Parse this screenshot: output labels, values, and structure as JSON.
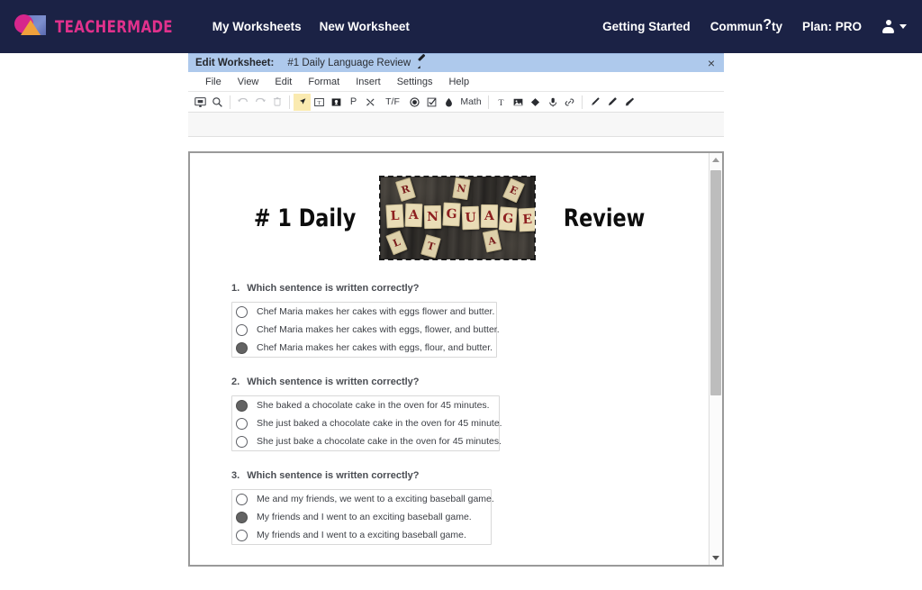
{
  "navbar": {
    "brand_name": "TEACHERMADE",
    "brand_color": "#e0318c",
    "background": "#1b2245",
    "logo_icon": "teachermade-logo-icon",
    "left_links": [
      {
        "label": "My Worksheets"
      },
      {
        "label": "New Worksheet"
      }
    ],
    "right_links": [
      {
        "label": "Getting Started"
      },
      {
        "label_prefix": "Commun",
        "label_mark": "?",
        "label_suffix": "ty"
      },
      {
        "label": "Plan: PRO"
      }
    ],
    "avatar_icon": "user-avatar-icon",
    "caret_icon": "chevron-down-icon"
  },
  "editor": {
    "title_label": "Edit Worksheet:",
    "worksheet_name": "#1 Daily Language Review",
    "edit_name_icon": "pencil-icon",
    "close_icon": "close-icon",
    "close_label": "×",
    "titlebar_color": "#aec9ec",
    "menus": [
      {
        "label": "File"
      },
      {
        "label": "View"
      },
      {
        "label": "Edit"
      },
      {
        "label": "Format"
      },
      {
        "label": "Insert"
      },
      {
        "label": "Settings"
      },
      {
        "label": "Help"
      }
    ],
    "toolbar_active_color": "#faeab0",
    "toolbar": [
      {
        "name": "present-mode-icon",
        "glyph": "",
        "group": 1,
        "state": "normal"
      },
      {
        "name": "zoom-icon",
        "glyph": "",
        "group": 1,
        "state": "normal"
      },
      {
        "name": "undo-icon",
        "glyph": "",
        "group": 2,
        "state": "disabled"
      },
      {
        "name": "redo-icon",
        "glyph": "",
        "group": 2,
        "state": "disabled"
      },
      {
        "name": "delete-icon",
        "glyph": "",
        "group": 2,
        "state": "disabled"
      },
      {
        "name": "select-cursor-icon",
        "glyph": "",
        "group": 3,
        "state": "active"
      },
      {
        "name": "text-box-icon",
        "glyph": "",
        "group": 3,
        "state": "normal"
      },
      {
        "name": "dropdown-field-icon",
        "glyph": "",
        "group": 3,
        "state": "normal"
      },
      {
        "name": "paragraph-icon",
        "glyph": "P",
        "group": 3,
        "state": "normal"
      },
      {
        "name": "shuffle-icon",
        "glyph": "",
        "group": 3,
        "state": "normal"
      },
      {
        "name": "true-false-icon",
        "glyph": "T/F",
        "group": 3,
        "state": "normal"
      },
      {
        "name": "radio-button-icon",
        "glyph": "",
        "group": 3,
        "state": "normal"
      },
      {
        "name": "checkbox-icon",
        "glyph": "",
        "group": 3,
        "state": "normal"
      },
      {
        "name": "droplet-icon",
        "glyph": "",
        "group": 3,
        "state": "normal"
      },
      {
        "name": "math-icon",
        "glyph": "Math",
        "group": 3,
        "state": "normal"
      },
      {
        "name": "text-icon",
        "glyph": "T",
        "group": 4,
        "state": "normal"
      },
      {
        "name": "image-icon",
        "glyph": "",
        "group": 4,
        "state": "normal"
      },
      {
        "name": "shape-icon",
        "glyph": "",
        "group": 4,
        "state": "normal"
      },
      {
        "name": "audio-recording-icon",
        "glyph": "",
        "group": 4,
        "state": "normal"
      },
      {
        "name": "link-icon",
        "glyph": "",
        "group": 4,
        "state": "normal"
      },
      {
        "name": "pen-icon",
        "glyph": "",
        "group": 5,
        "state": "normal"
      },
      {
        "name": "highlighter-icon",
        "glyph": "",
        "group": 5,
        "state": "normal"
      },
      {
        "name": "eraser-icon",
        "glyph": "",
        "group": 5,
        "state": "normal"
      }
    ]
  },
  "worksheet": {
    "title_left": "# 1  Daily",
    "title_right": "Review",
    "header_image": {
      "name": "language-scrabble-tiles-image",
      "alt_word": "LANGUAGE",
      "tiles": [
        "L",
        "A",
        "N",
        "G",
        "U",
        "A",
        "G",
        "E"
      ],
      "scatter_tiles": [
        "L",
        "T",
        "A",
        "E",
        "R",
        "N"
      ],
      "selected": true,
      "tile_color": "#e9dcb6",
      "letter_color": "#8e2020",
      "background_color": "#2e2b28"
    },
    "questions": [
      {
        "number": "1.",
        "prompt": "Which sentence is written correctly?",
        "options": [
          {
            "text": "Chef Maria makes her cakes with eggs flower and butter.",
            "selected": false
          },
          {
            "text": "Chef Maria makes her cakes with eggs, flower, and butter.",
            "selected": false
          },
          {
            "text": "Chef Maria makes her cakes with eggs, flour, and butter.",
            "selected": true
          }
        ]
      },
      {
        "number": "2.",
        "prompt": "Which sentence is written correctly?",
        "options": [
          {
            "text": "She baked a chocolate cake in the oven for 45 minutes.",
            "selected": true
          },
          {
            "text": "She just baked a chocolate cake in the oven for 45 minute.",
            "selected": false
          },
          {
            "text": "She just bake a chocolate cake in the oven for 45 minutes.",
            "selected": false
          }
        ]
      },
      {
        "number": "3.",
        "prompt": "Which sentence is written correctly?",
        "options": [
          {
            "text": "Me and my friends, we went to a exciting baseball game.",
            "selected": false
          },
          {
            "text": "My friends and I went to an exciting baseball game.",
            "selected": true
          },
          {
            "text": "My friends and I went to a exciting baseball game.",
            "selected": false
          }
        ]
      }
    ],
    "scrollbar": {
      "up_icon": "scroll-up-arrow-icon",
      "down_icon": "scroll-down-arrow-icon",
      "thumb_name": "scroll-thumb"
    }
  }
}
